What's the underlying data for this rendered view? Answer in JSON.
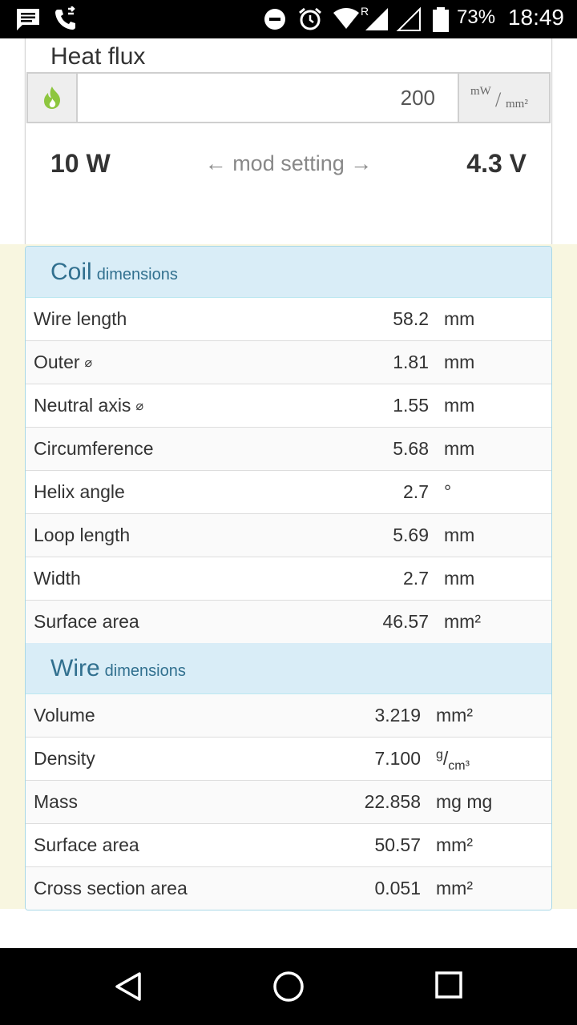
{
  "status_bar": {
    "battery": "73%",
    "time": "18:49",
    "roaming": "R"
  },
  "heat_flux": {
    "title": "Heat flux",
    "value": "200",
    "unit_numerator": "mW",
    "unit_slash": "/",
    "unit_denominator": "mm²",
    "watts": "10 W",
    "mod_label": "← mod setting →",
    "volts": "4.3 V",
    "icon": "flame-icon",
    "icon_color": "#8dc63f"
  },
  "coil": {
    "title": "Coil",
    "subtitle": "dimensions",
    "rows": [
      {
        "label": "Wire length",
        "diam": "",
        "value": "58.2",
        "unit": "mm"
      },
      {
        "label": "Outer",
        "diam": "⌀",
        "value": "1.81",
        "unit": "mm"
      },
      {
        "label": "Neutral axis",
        "diam": "⌀",
        "value": "1.55",
        "unit": "mm"
      },
      {
        "label": "Circumference",
        "diam": "",
        "value": "5.68",
        "unit": "mm"
      },
      {
        "label": "Helix angle",
        "diam": "",
        "value": "2.7",
        "unit": "°"
      },
      {
        "label": "Loop length",
        "diam": "",
        "value": "5.69",
        "unit": "mm"
      },
      {
        "label": "Width",
        "diam": "",
        "value": "2.7",
        "unit": "mm"
      },
      {
        "label": "Surface area",
        "diam": "",
        "value": "46.57",
        "unit": "mm²"
      }
    ]
  },
  "wire": {
    "title": "Wire",
    "subtitle": "dimensions",
    "rows": [
      {
        "label": "Volume",
        "value": "3.219",
        "unit": "mm²"
      },
      {
        "label": "Density",
        "value": "7.100",
        "unit_sup": "g",
        "unit_slash": "/",
        "unit_sub": "cm³"
      },
      {
        "label": "Mass",
        "value": "22.858",
        "unit": "mg mg"
      },
      {
        "label": "Surface area",
        "value": "50.57",
        "unit": "mm²"
      },
      {
        "label": "Cross section area",
        "value": "0.051",
        "unit": "mm²"
      }
    ]
  },
  "colors": {
    "panel_heading_bg": "#d9edf7",
    "panel_heading_text": "#31708f",
    "section_bg": "#f8f6e0"
  }
}
